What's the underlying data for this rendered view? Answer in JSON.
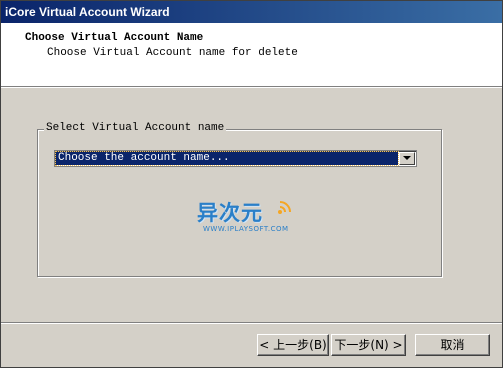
{
  "window": {
    "title": "iCore Virtual Account Wizard"
  },
  "header": {
    "title": "Choose Virtual Account Name",
    "subtitle": "Choose Virtual Account name for delete"
  },
  "group": {
    "label": "Select Virtual Account name",
    "combo_value": "Choose the account name..."
  },
  "watermark": {
    "logo_text": "异次元",
    "url": "WWW.IPLAYSOFT.COM"
  },
  "buttons": {
    "back": "< 上一步(B)",
    "next": "下一步(N) >",
    "cancel": "取消"
  },
  "colors": {
    "titlebar": "#0a246a",
    "selection": "#0a246a",
    "face": "#d4d0c8",
    "watermark": "#2a7fc8"
  }
}
